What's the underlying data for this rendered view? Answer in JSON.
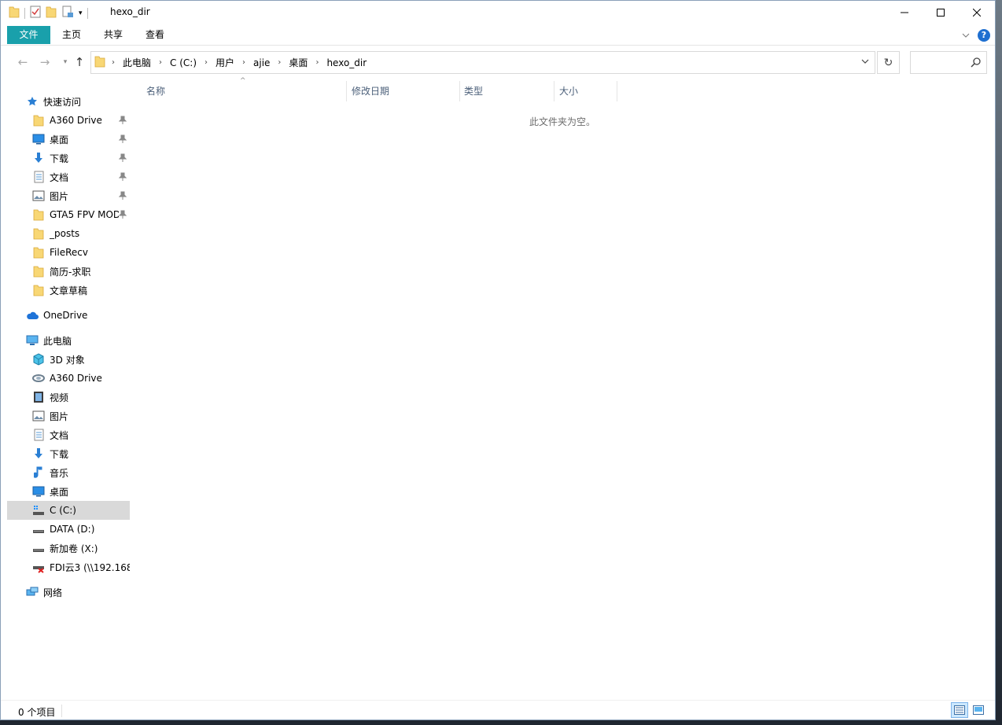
{
  "window": {
    "title": "hexo_dir"
  },
  "ribbon": {
    "tabs": [
      {
        "label": "文件"
      },
      {
        "label": "主页"
      },
      {
        "label": "共享"
      },
      {
        "label": "查看"
      }
    ]
  },
  "address": {
    "crumbs": [
      "此电脑",
      "C (C:)",
      "用户",
      "ajie",
      "桌面",
      "hexo_dir"
    ],
    "search_placeholder": ""
  },
  "sidebar": {
    "quick_access": {
      "label": "快速访问"
    },
    "quick_items": [
      {
        "label": "A360 Drive",
        "icon": "folder-icon",
        "pinned": true
      },
      {
        "label": "桌面",
        "icon": "desktop-icon",
        "pinned": true
      },
      {
        "label": "下载",
        "icon": "download-icon",
        "pinned": true
      },
      {
        "label": "文档",
        "icon": "document-icon",
        "pinned": true
      },
      {
        "label": "图片",
        "icon": "picture-icon",
        "pinned": true
      },
      {
        "label": "GTA5 FPV MOD",
        "icon": "folder-icon",
        "pinned": true
      },
      {
        "label": "_posts",
        "icon": "folder-icon",
        "pinned": false
      },
      {
        "label": "FileRecv",
        "icon": "folder-icon",
        "pinned": false
      },
      {
        "label": "简历-求职",
        "icon": "folder-icon",
        "pinned": false
      },
      {
        "label": "文章草稿",
        "icon": "folder-icon",
        "pinned": false
      }
    ],
    "onedrive": {
      "label": "OneDrive"
    },
    "this_pc": {
      "label": "此电脑"
    },
    "pc_items": [
      {
        "label": "3D 对象",
        "icon": "3d-objects-icon"
      },
      {
        "label": "A360 Drive",
        "icon": "a360-icon"
      },
      {
        "label": "视频",
        "icon": "video-icon"
      },
      {
        "label": "图片",
        "icon": "picture-icon"
      },
      {
        "label": "文档",
        "icon": "document-icon"
      },
      {
        "label": "下载",
        "icon": "download-icon"
      },
      {
        "label": "音乐",
        "icon": "music-icon"
      },
      {
        "label": "桌面",
        "icon": "desktop-icon"
      },
      {
        "label": "C (C:)",
        "icon": "system-drive-icon",
        "selected": true
      },
      {
        "label": "DATA (D:)",
        "icon": "drive-icon"
      },
      {
        "label": "新加卷 (X:)",
        "icon": "drive-icon"
      },
      {
        "label": "FDI云3 (\\\\192.168.",
        "icon": "network-drive-disconnected-icon"
      }
    ],
    "network": {
      "label": "网络"
    }
  },
  "content": {
    "columns": [
      {
        "label": "名称"
      },
      {
        "label": "修改日期"
      },
      {
        "label": "类型"
      },
      {
        "label": "大小"
      }
    ],
    "empty_message": "此文件夹为空。"
  },
  "status": {
    "item_count": "0 个项目"
  },
  "colors": {
    "accent": "#19a0ab",
    "selection": "#d9d9d9",
    "header_text": "#4c607a"
  }
}
